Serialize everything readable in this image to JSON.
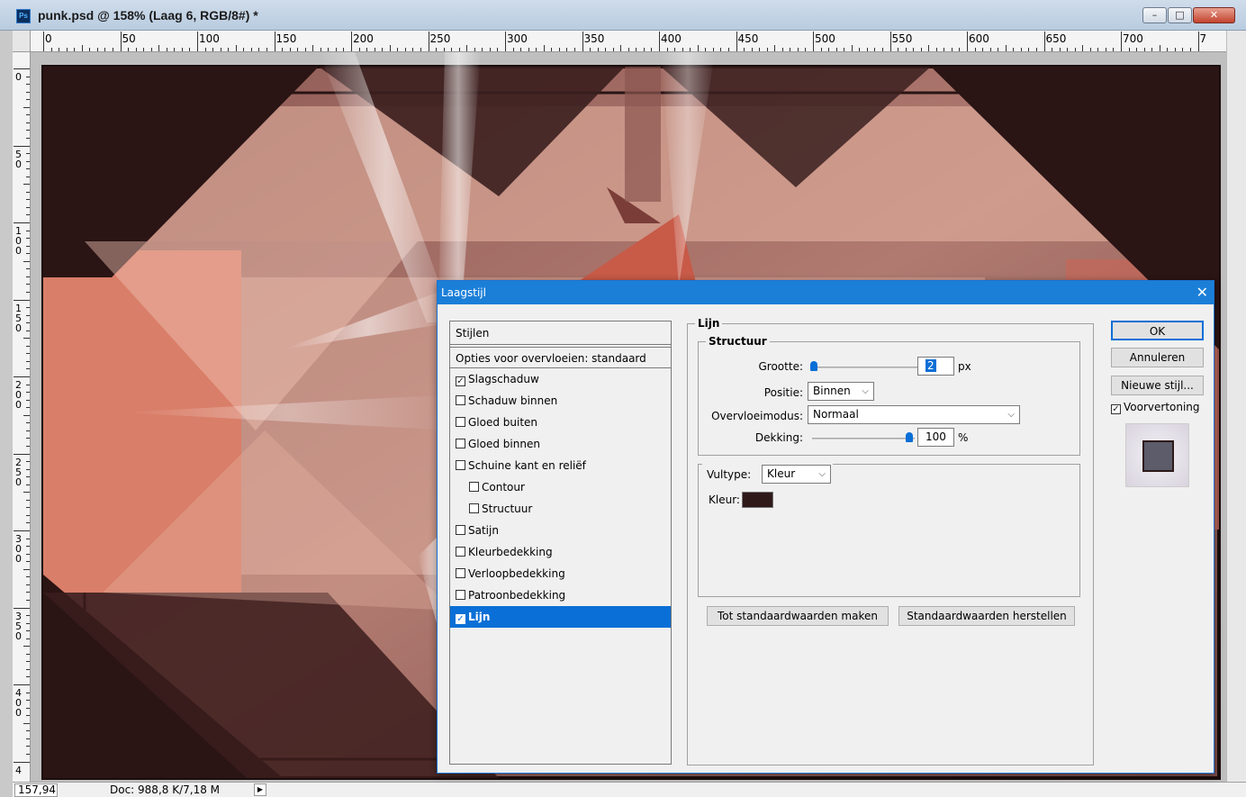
{
  "window": {
    "app_icon_label": "Ps",
    "title": "punk.psd @ 158% (Laag 6, RGB/8#) *",
    "minimize_glyph": "–",
    "maximize_glyph": "□",
    "close_glyph": "✕"
  },
  "ruler": {
    "h_labels": [
      "0",
      "50",
      "100",
      "150",
      "200",
      "250",
      "300",
      "350",
      "400",
      "450",
      "500",
      "550",
      "600",
      "650",
      "700",
      "7"
    ],
    "v_labels": [
      "0",
      "50",
      "100",
      "150",
      "200",
      "250",
      "300",
      "350",
      "400",
      "4"
    ]
  },
  "statusbar": {
    "zoom": "157,94",
    "doc_info": "Doc: 988,8 K/7,18 M",
    "arrow": "▶"
  },
  "dialog": {
    "title": "Laagstijl",
    "close_glyph": "✕",
    "styles_header": "Stijlen",
    "blend_options": "Opties voor overvloeien: standaard",
    "styles": [
      {
        "label": "Slagschaduw",
        "checked": true
      },
      {
        "label": "Schaduw binnen",
        "checked": false
      },
      {
        "label": "Gloed buiten",
        "checked": false
      },
      {
        "label": "Gloed binnen",
        "checked": false
      },
      {
        "label": "Schuine kant en reliëf",
        "checked": false
      },
      {
        "label": "Contour",
        "checked": false
      },
      {
        "label": "Structuur",
        "checked": false
      },
      {
        "label": "Satijn",
        "checked": false
      },
      {
        "label": "Kleurbedekking",
        "checked": false
      },
      {
        "label": "Verloopbedekking",
        "checked": false
      },
      {
        "label": "Patroonbedekking",
        "checked": false
      },
      {
        "label": "Lijn",
        "checked": true
      }
    ],
    "check_glyph": "✓",
    "lijn_legend": "Lijn",
    "structuur_legend": "Structuur",
    "grootte_label": "Grootte:",
    "grootte_value": "2",
    "grootte_unit": "px",
    "positie_label": "Positie:",
    "positie_value": "Binnen",
    "overvloeimodus_label": "Overvloeimodus:",
    "overvloeimodus_value": "Normaal",
    "dekking_label": "Dekking:",
    "dekking_value": "100",
    "dekking_unit": "%",
    "vultype_label": "Vultype:",
    "vultype_value": "Kleur",
    "kleur_label": "Kleur:",
    "stroke_color": "#2f1a19",
    "set_default_button": "Tot standaardwaarden maken",
    "reset_default_button": "Standaardwaarden herstellen",
    "ok_button": "OK",
    "cancel_button": "Annuleren",
    "new_style_button": "Nieuwe stijl...",
    "preview_label": "Voorvertoning",
    "preview_checked": true,
    "dropdown_glyph": "⌵"
  },
  "colors": {
    "dialog_accent": "#1b7fd8",
    "selection": "#0a6fd6",
    "canvas_dark": "#2a1414",
    "canvas_salmon": "#d97e68",
    "canvas_rose": "#9b6560"
  }
}
